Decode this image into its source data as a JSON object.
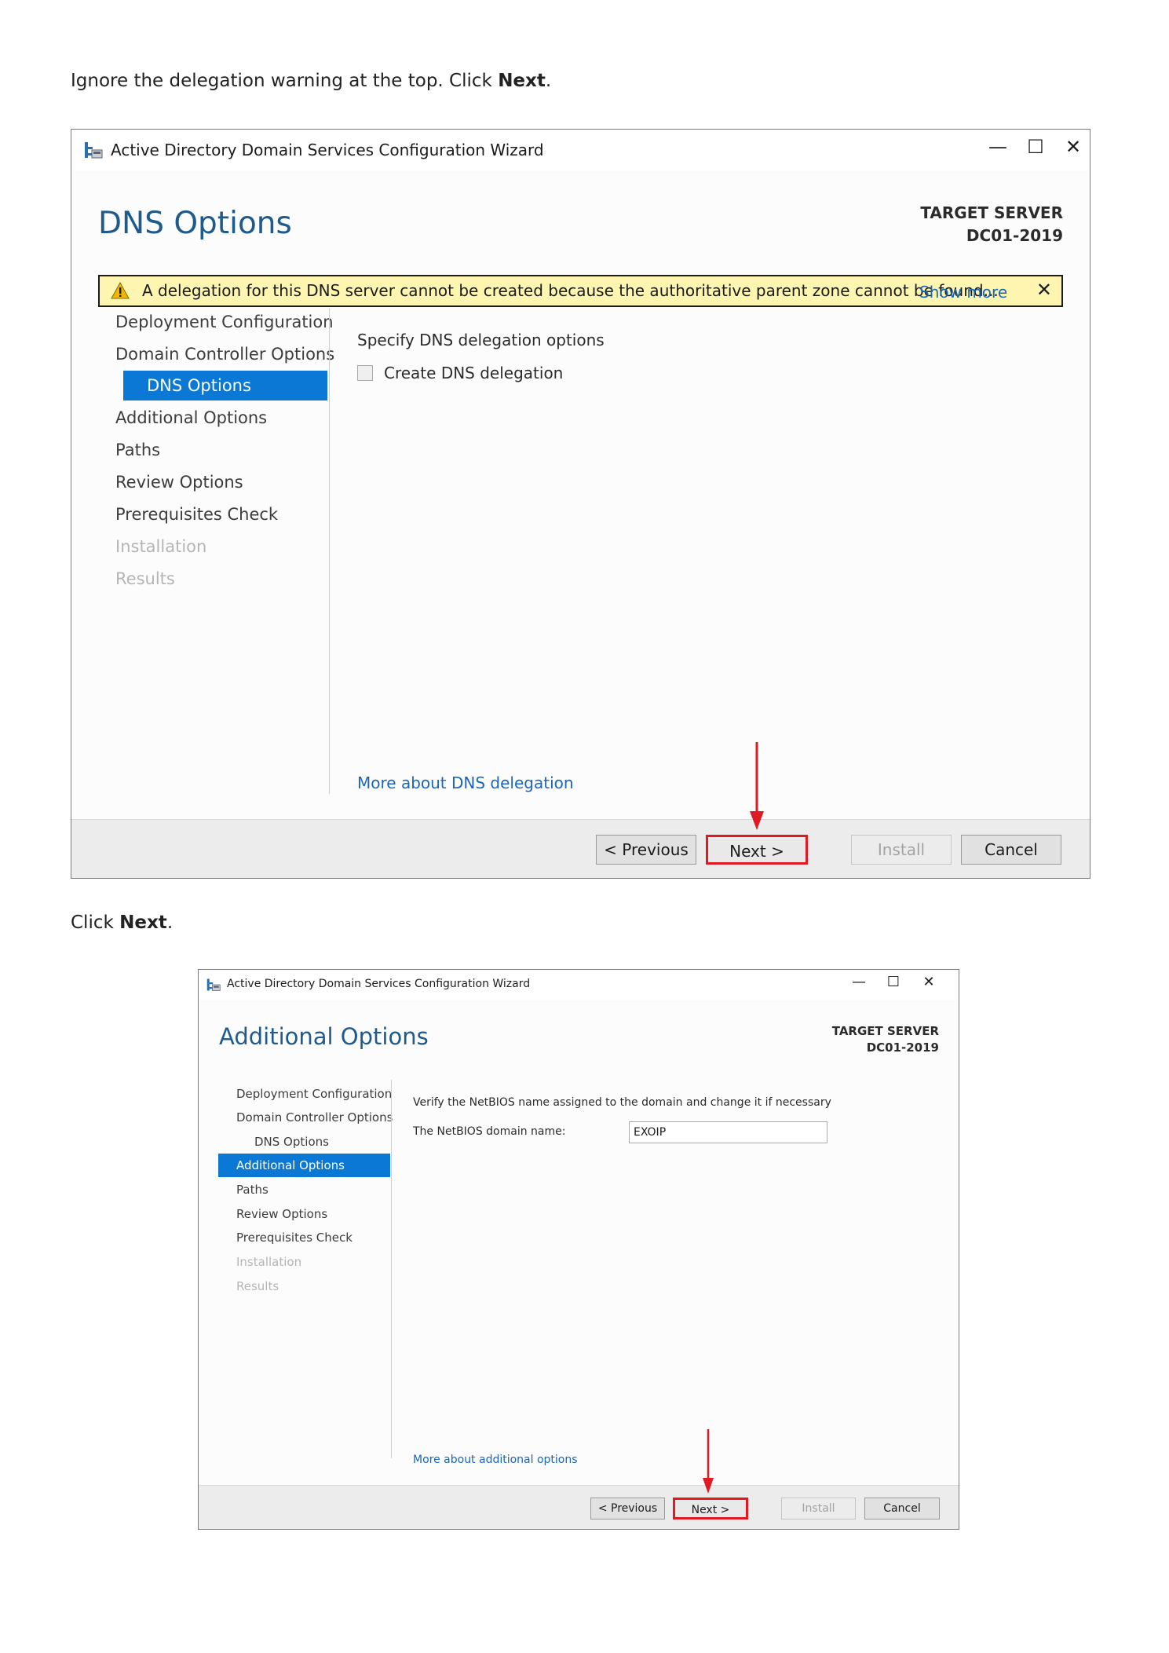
{
  "step1": {
    "instruction_before": "Ignore the delegation warning at the top. Click ",
    "instruction_bold": "Next",
    "instruction_after": ".",
    "window": {
      "title": "Active Directory Domain Services Configuration Wizard",
      "controls": {
        "minimize": "—",
        "maximize": "☐",
        "close": "✕"
      },
      "page_title": "DNS Options",
      "target_label": "TARGET SERVER",
      "target_name": "DC01-2019",
      "warning": {
        "text": "A delegation for this DNS server cannot be created because the authoritative parent zone cannot be found...",
        "show_more": "Show more",
        "close": "✕"
      },
      "nav": [
        {
          "label": "Deployment Configuration",
          "state": "normal"
        },
        {
          "label": "Domain Controller Options",
          "state": "normal"
        },
        {
          "label": "DNS Options",
          "state": "active"
        },
        {
          "label": "Additional Options",
          "state": "normal"
        },
        {
          "label": "Paths",
          "state": "normal"
        },
        {
          "label": "Review Options",
          "state": "normal"
        },
        {
          "label": "Prerequisites Check",
          "state": "normal"
        },
        {
          "label": "Installation",
          "state": "disabled"
        },
        {
          "label": "Results",
          "state": "disabled"
        }
      ],
      "section_label": "Specify DNS delegation options",
      "checkbox_label": "Create DNS delegation",
      "checkbox_checked": false,
      "more_link": "More about DNS delegation",
      "buttons": {
        "previous": "< Previous",
        "next": "Next >",
        "install": "Install",
        "cancel": "Cancel"
      }
    }
  },
  "step2": {
    "instruction_before": "Click ",
    "instruction_bold": "Next",
    "instruction_after": ".",
    "window": {
      "title": "Active Directory Domain Services Configuration Wizard",
      "controls": {
        "minimize": "—",
        "maximize": "☐",
        "close": "✕"
      },
      "page_title": "Additional Options",
      "target_label": "TARGET SERVER",
      "target_name": "DC01-2019",
      "nav": [
        {
          "label": "Deployment Configuration",
          "state": "normal"
        },
        {
          "label": "Domain Controller Options",
          "state": "normal"
        },
        {
          "label": "DNS Options",
          "state": "normal"
        },
        {
          "label": "Additional Options",
          "state": "active"
        },
        {
          "label": "Paths",
          "state": "normal"
        },
        {
          "label": "Review Options",
          "state": "normal"
        },
        {
          "label": "Prerequisites Check",
          "state": "normal"
        },
        {
          "label": "Installation",
          "state": "disabled"
        },
        {
          "label": "Results",
          "state": "disabled"
        }
      ],
      "section_label": "Verify the NetBIOS name assigned to the domain and change it if necessary",
      "field_label": "The NetBIOS domain name:",
      "netbios_value": "EXOIP",
      "more_link": "More about additional options",
      "buttons": {
        "previous": "< Previous",
        "next": "Next >",
        "install": "Install",
        "cancel": "Cancel"
      }
    }
  },
  "colors": {
    "accent": "#0a78d4",
    "heading": "#1e5a8c",
    "link": "#1a66b8",
    "warning_bg": "#fdf5b0",
    "highlight": "#e01a22"
  },
  "icons": [
    "app-icon",
    "warning-icon",
    "minimize-icon",
    "maximize-icon",
    "close-icon",
    "arrow-down-icon"
  ]
}
